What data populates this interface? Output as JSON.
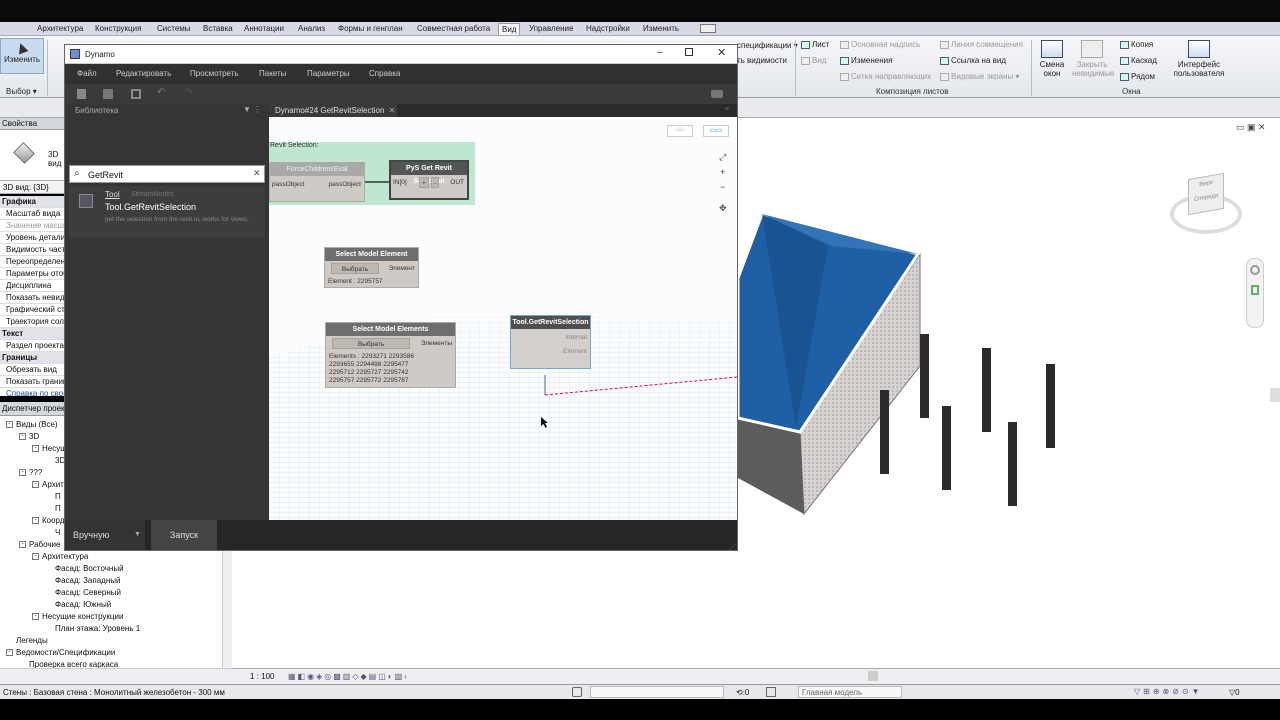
{
  "ribbon": {
    "tabs": [
      "Архитектура",
      "Конструкция",
      "Системы",
      "Вставка",
      "Аннотации",
      "Анализ",
      "Формы и генплан",
      "Совместная работа",
      "Вид",
      "Управление",
      "Надстройки",
      "Изменить"
    ],
    "active_tab": "Вид",
    "modify_label": "Изменить",
    "select_label": "Выбор",
    "items": {
      "list": "Лист",
      "main_label": "Основная надпись",
      "matchline": "Линия совмещения",
      "view": "Вид",
      "revisions": "Изменения",
      "view_ref": "Ссылка на вид",
      "guide_grid": "Сетка направляющих",
      "viewports": "Видовые экраны",
      "copy": "Копия",
      "cascade": "Каскад",
      "tile": "Рядом",
      "switch_windows": "Смена окон",
      "close_hidden": "Закрыть невидимые",
      "user_interface": "Интерфейс пользователя",
      "specification": "спецификации",
      "visibility": "ть видимости"
    },
    "panels": {
      "sheet_composition": "Композиция листов",
      "windows": "Окна"
    }
  },
  "properties": {
    "title": "Свойства",
    "view_type": "3D вид",
    "selector": "3D вид: {3D}",
    "rows": [
      {
        "text": "Графика",
        "head": true
      },
      {
        "text": "Масштаб вида",
        "head": false
      },
      {
        "text": "Значение масштаба",
        "head": false,
        "dim": true
      },
      {
        "text": "Уровень детализации",
        "head": false
      },
      {
        "text": "Видимость частей",
        "head": false
      },
      {
        "text": "Переопределения",
        "head": false
      },
      {
        "text": "Параметры отображения",
        "head": false
      },
      {
        "text": "Дисциплина",
        "head": false
      },
      {
        "text": "Показать невидимые",
        "head": false
      },
      {
        "text": "Графический стиль",
        "head": false
      },
      {
        "text": "Траектория солнца",
        "head": false
      },
      {
        "text": "Текст",
        "head": true
      },
      {
        "text": "Раздел проекта",
        "head": false
      },
      {
        "text": "Границы",
        "head": true
      },
      {
        "text": "Обрезать вид",
        "head": false
      },
      {
        "text": "Показать границы",
        "head": false
      }
    ],
    "help_link": "Справка по свойствам"
  },
  "browser": {
    "title": "Диспетчер проекта",
    "items": [
      {
        "text": "Виды (Все)",
        "indent": 0,
        "box": "-"
      },
      {
        "text": "3D",
        "indent": 1,
        "box": "-"
      },
      {
        "text": "Несущие",
        "indent": 2,
        "box": "-"
      },
      {
        "text": "3D",
        "indent": 3,
        "box": ""
      },
      {
        "text": "???",
        "indent": 1,
        "box": "-"
      },
      {
        "text": "Архитектура",
        "indent": 2,
        "box": "-"
      },
      {
        "text": "П",
        "indent": 3,
        "box": ""
      },
      {
        "text": "П",
        "indent": 3,
        "box": ""
      },
      {
        "text": "Координация",
        "indent": 2,
        "box": "-"
      },
      {
        "text": "Ч",
        "indent": 3,
        "box": ""
      },
      {
        "text": "Рабочие",
        "indent": 1,
        "box": "-"
      },
      {
        "text": "Архитектура",
        "indent": 2,
        "box": "-"
      },
      {
        "text": "Фасад: Восточный",
        "indent": 3,
        "box": ""
      },
      {
        "text": "Фасад: Западный",
        "indent": 3,
        "box": ""
      },
      {
        "text": "Фасад: Северный",
        "indent": 3,
        "box": ""
      },
      {
        "text": "Фасад: Южный",
        "indent": 3,
        "box": ""
      },
      {
        "text": "Несущие конструкции",
        "indent": 2,
        "box": "-"
      },
      {
        "text": "План этажа: Уровень 1",
        "indent": 3,
        "box": ""
      },
      {
        "text": "Легенды",
        "indent": 0,
        "box": ""
      },
      {
        "text": "Ведомости/Спецификации",
        "indent": 0,
        "box": "-"
      },
      {
        "text": "Проверка всего каркаса",
        "indent": 1,
        "box": ""
      }
    ]
  },
  "viewbar": {
    "scale": "1 : 100"
  },
  "statusbar": {
    "text": "Стены : Базовая стена : Монолитный железобетон - 300 мм",
    "count": ":0",
    "model": "Главная модель",
    "filter_count": "0"
  },
  "viewcube": {
    "top": "Верх",
    "front": "Спереди"
  },
  "dynamo": {
    "title": "Dynamo",
    "menu": [
      "Файл",
      "Редактировать",
      "Просмотреть",
      "Пакеты",
      "Параметры",
      "Справка"
    ],
    "library_label": "Библиотека",
    "search_value": "GetRevit",
    "result": {
      "category": "Tool",
      "package": "StreamNodes",
      "name": "Tool.GetRevitSelection",
      "description": "get the selection from the revit ui, works for views."
    },
    "tab_label": "Dynamo#24 GetRevitSelection",
    "run_mode": "Вручную",
    "run_button": "Запуск",
    "group_label": "Revit Selection:",
    "nodes": {
      "force": {
        "title": "ForceChildrensEval",
        "in": "passObject",
        "out": "passObject"
      },
      "pys": {
        "title": "PyS Get Revit Selection",
        "in": "IN[0]",
        "out": "OUT"
      },
      "sme": {
        "title": "Select Model Element",
        "button": "Выбрать",
        "out": "Элемент",
        "value": "Element : 2295757"
      },
      "smes": {
        "title": "Select Model Elements",
        "button": "Выбрать",
        "out": "Элементы",
        "lines": [
          "Elements : 2293271 2293586",
          "2293655 2294498 2295477",
          "2295712 2295727 2295742",
          "2295757 2295772 2295787"
        ]
      },
      "tool": {
        "title": "Tool.GetRevitSelection",
        "out1": "Internal",
        "out2": "Element"
      }
    }
  }
}
